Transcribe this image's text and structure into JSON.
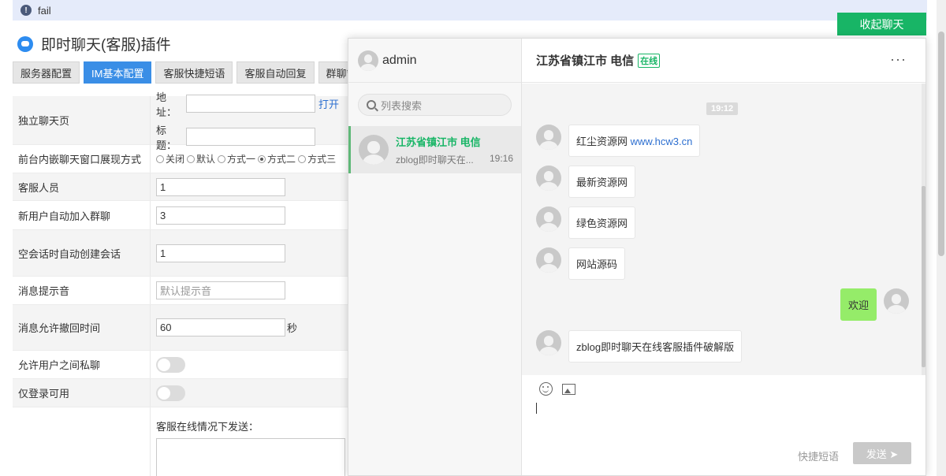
{
  "alert": {
    "icon": "info-icon",
    "text": "fail"
  },
  "page": {
    "title": "即时聊天(客服)插件",
    "icon": "chat-plugin-logo-icon"
  },
  "tabs": [
    "服务器配置",
    "IM基本配置",
    "客服快捷短语",
    "客服自动回复",
    "群聊管"
  ],
  "active_tab_index": 1,
  "settings": {
    "standalone": {
      "label": "独立聊天页",
      "addr_label": "地址：",
      "addr_value": "",
      "open_link": "打开",
      "title_label": "标题：",
      "title_value": ""
    },
    "embed": {
      "label": "前台内嵌聊天窗口展现方式",
      "options": [
        "关闭",
        "默认",
        "方式一",
        "方式二",
        "方式三"
      ],
      "selected": "方式二"
    },
    "staff": {
      "label": "客服人员",
      "value": "1"
    },
    "auto_join": {
      "label": "新用户自动加入群聊",
      "value": "3"
    },
    "empty_session": {
      "label": "空会话时自动创建会话",
      "value": "1"
    },
    "sound": {
      "label": "消息提示音",
      "placeholder": "默认提示音"
    },
    "recall": {
      "label": "消息允许撤回时间",
      "value": "60",
      "unit": "秒"
    },
    "private_chat": {
      "label": "允许用户之间私聊",
      "enabled": false
    },
    "login_only": {
      "label": "仅登录可用",
      "enabled": false
    },
    "online_send": {
      "label": "客服在线情况下发送："
    }
  },
  "collapse_button": "收起聊天",
  "chat": {
    "user": "admin",
    "search_placeholder": "列表搜索",
    "conversation": {
      "name": "江苏省镇江市 电信",
      "preview": "zblog即时聊天在...",
      "time": "19:16"
    },
    "header": {
      "title": "江苏省镇江市 电信",
      "status": "在线",
      "more": "···"
    },
    "time_divider": "19:12",
    "messages": [
      {
        "from": "other",
        "text": "红尘资源网 ",
        "link": "www.hcw3.cn"
      },
      {
        "from": "other",
        "text": "最新资源网"
      },
      {
        "from": "other",
        "text": "绿色资源网"
      },
      {
        "from": "other",
        "text": "网站源码"
      },
      {
        "from": "me",
        "text": "欢迎"
      },
      {
        "from": "other",
        "text": "zblog即时聊天在线客服插件破解版"
      }
    ],
    "toolbar": {
      "emoji": "emoji-icon",
      "image": "image-icon"
    },
    "quick_phrase": "快捷短语",
    "send": "发送 ➤"
  }
}
